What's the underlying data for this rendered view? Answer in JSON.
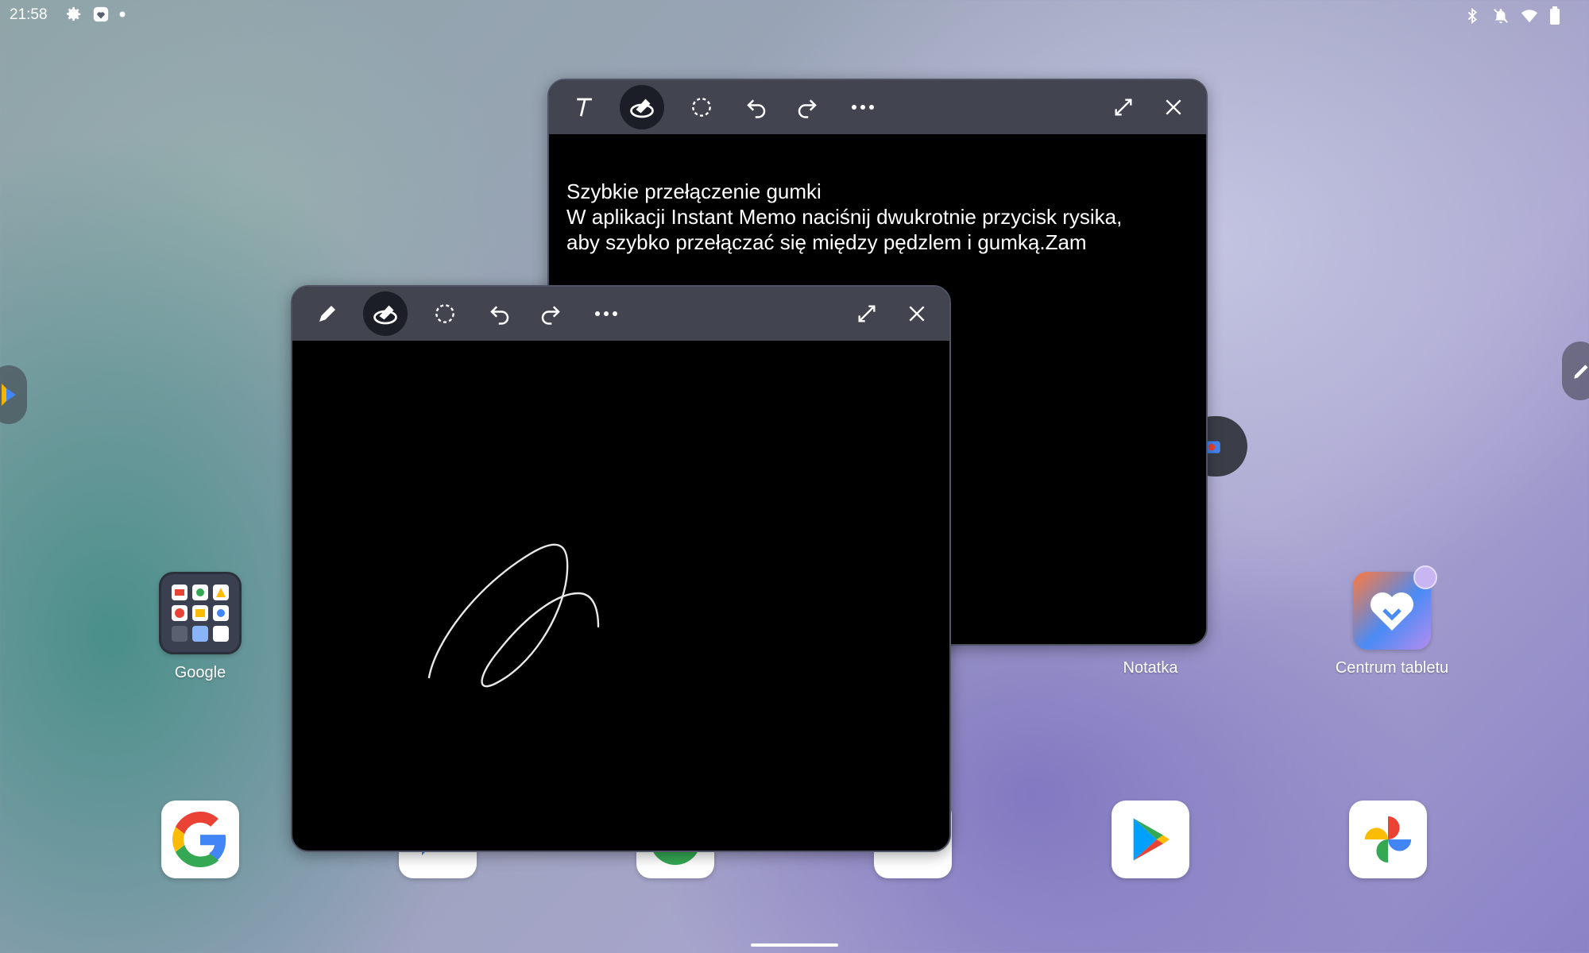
{
  "status_bar": {
    "time": "21:58",
    "left_icons": [
      "gear-icon",
      "heart-shield-icon",
      "dot-icon"
    ],
    "right_icons": [
      "bluetooth-icon",
      "bell-off-icon",
      "wifi-icon",
      "battery-icon"
    ]
  },
  "memo_text": {
    "toolbar": [
      "text-tool",
      "eraser",
      "lasso",
      "undo",
      "redo",
      "more",
      "expand",
      "close"
    ],
    "lines": [
      "Szybkie przełączenie gumki",
      "W aplikacji Instant Memo naciśnij dwukrotnie przycisk rysika,",
      "aby szybko przełączać się między pędzlem i gumką.Zam"
    ]
  },
  "memo_drawing": {
    "toolbar": [
      "pen",
      "eraser",
      "lasso",
      "undo",
      "redo",
      "more",
      "expand",
      "close"
    ]
  },
  "apps": {
    "google_folder": "Google",
    "notatka": "Notatka",
    "centrum": "Centrum tabletu"
  },
  "dock": [
    "google-icon",
    "messages-icon",
    "chrome-icon",
    "files-icon",
    "play-store-icon",
    "photos-icon"
  ],
  "colors": {
    "toolbar": "#42454f",
    "active_tool": "#1b1e27",
    "canvas": "#000000"
  }
}
